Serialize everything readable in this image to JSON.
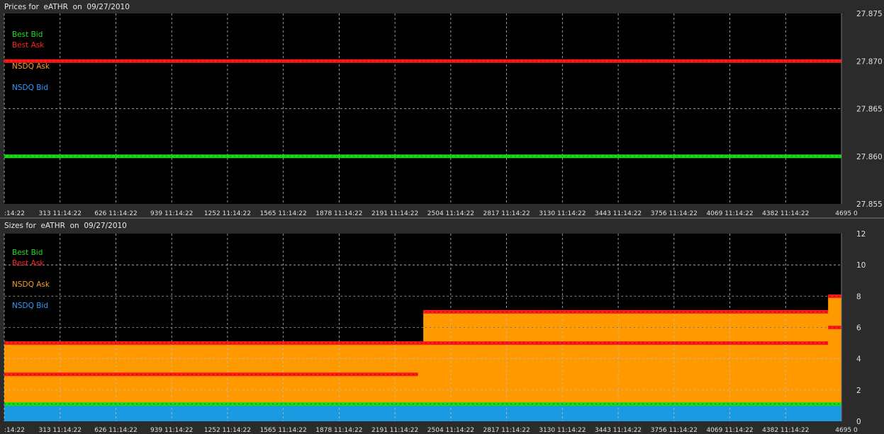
{
  "chart_data": [
    {
      "type": "line",
      "title": "Prices for  eATHR  on  09/27/2010",
      "x_tick_labels": [
        ":14:22",
        "313 11:14:22",
        "626 11:14:22",
        "939 11:14:22",
        "1252 11:14:22",
        "1565 11:14:22",
        "1878 11:14:22",
        "2191 11:14:22",
        "2504 11:14:22",
        "2817 11:14:22",
        "3130 11:14:22",
        "3443 11:14:22",
        "3756 11:14:22",
        "4069 11:14:22",
        "4382 11:14:22",
        "4695 0"
      ],
      "x_ticks": [
        0,
        313,
        626,
        939,
        1252,
        1565,
        1878,
        2191,
        2504,
        2817,
        3130,
        3443,
        3756,
        4069,
        4382,
        4695
      ],
      "xlim": [
        0,
        4695
      ],
      "ylim": [
        27.855,
        27.875
      ],
      "y_ticks": [
        27.855,
        27.86,
        27.865,
        27.87,
        27.875
      ],
      "y_tick_labels": [
        "27.855",
        "27.860",
        "27.865",
        "27.870",
        "27.875"
      ],
      "grid": true,
      "legend": [
        "Best Bid",
        "Best Ask",
        "NSDQ Ask",
        "NSDQ Bid"
      ],
      "legend_colors": [
        "#22dd22",
        "#ff2020",
        "#f5a020",
        "#3399ff"
      ],
      "series": [
        {
          "name": "Best Ask",
          "color": "#ff1a1a",
          "style": "line",
          "x": [
            0,
            4695
          ],
          "y": [
            27.87,
            27.87
          ]
        },
        {
          "name": "Best Bid",
          "color": "#11dd11",
          "style": "line",
          "x": [
            0,
            4695
          ],
          "y": [
            27.86,
            27.86
          ]
        }
      ]
    },
    {
      "type": "area",
      "title": "Sizes for  eATHR  on  09/27/2010",
      "x_tick_labels": [
        ":14:22",
        "313 11:14:22",
        "626 11:14:22",
        "939 11:14:22",
        "1252 11:14:22",
        "1565 11:14:22",
        "1878 11:14:22",
        "2191 11:14:22",
        "2504 11:14:22",
        "2817 11:14:22",
        "3130 11:14:22",
        "3443 11:14:22",
        "3756 11:14:22",
        "4069 11:14:22",
        "4382 11:14:22",
        "4695 0"
      ],
      "x_ticks": [
        0,
        313,
        626,
        939,
        1252,
        1565,
        1878,
        2191,
        2504,
        2817,
        3130,
        3443,
        3756,
        4069,
        4382,
        4695
      ],
      "xlim": [
        0,
        4695
      ],
      "ylim": [
        0,
        12
      ],
      "y_ticks": [
        0,
        2,
        4,
        6,
        8,
        10,
        12
      ],
      "y_tick_labels": [
        "0",
        "2",
        "4",
        "6",
        "8",
        "10",
        "12"
      ],
      "grid": true,
      "legend": [
        "Best Bid",
        "Best Ask",
        "NSDQ Ask",
        "NSDQ Bid"
      ],
      "legend_colors": [
        "#22dd22",
        "#ff2020",
        "#f5a020",
        "#3399ff"
      ],
      "series": [
        {
          "name": "NSDQ Ask",
          "color": "#ff9900",
          "style": "area",
          "x": [
            0,
            2350,
            2350,
            4620,
            4620,
            4695
          ],
          "y": [
            5,
            5,
            7,
            7,
            8,
            8
          ]
        },
        {
          "name": "NSDQ Bid",
          "color": "#1a9ae0",
          "style": "area",
          "x": [
            0,
            4695
          ],
          "y": [
            1,
            1
          ]
        },
        {
          "name": "Best Bid",
          "color": "#11dd11",
          "style": "line",
          "x": [
            0,
            4695
          ],
          "y": [
            1.1,
            1.1
          ]
        },
        {
          "name": "Best Ask",
          "color": "#ff1a1a",
          "style": "line",
          "x": [
            0,
            2320
          ],
          "y": [
            3,
            3
          ]
        },
        {
          "name": "Best Ask",
          "color": "#ff1a1a",
          "style": "line",
          "x": [
            0,
            4620
          ],
          "y": [
            5,
            5
          ]
        },
        {
          "name": "Best Ask",
          "color": "#ff1a1a",
          "style": "line",
          "x": [
            2350,
            4620
          ],
          "y": [
            7,
            7
          ]
        },
        {
          "name": "Best Ask",
          "color": "#ff1a1a",
          "style": "line",
          "x": [
            4620,
            4695
          ],
          "y": [
            8,
            8
          ]
        },
        {
          "name": "Best Ask",
          "color": "#ff1a1a",
          "style": "line",
          "x": [
            4620,
            4695
          ],
          "y": [
            6,
            6
          ]
        }
      ]
    }
  ]
}
